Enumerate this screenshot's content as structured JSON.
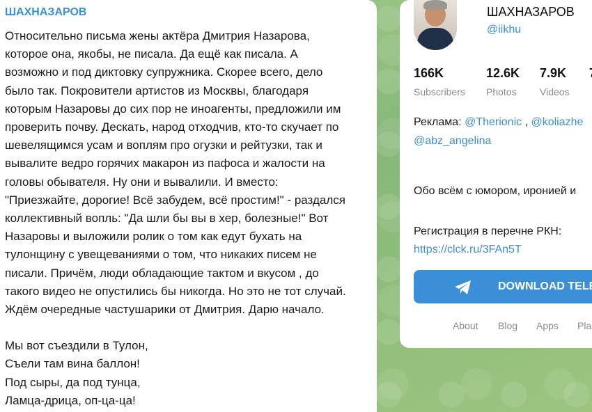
{
  "message": {
    "author": "ШАХНАЗАРОВ",
    "paragraph1": "Относительно письма жены актёра Дмитрия Назарова,\nкоторое она, якобы, не писала. Да ещё как писала. А\nвозможно и под диктовку супружника. Скорее всего, дело\nбыло так. Покровители артистов из Москвы, благодаря\nкоторым Назаровы до сих пор не иноагенты, предложили им\nпроверить почву. Дескать, народ отходчив, кто-то скучает по\nшевелящимся усам и воплям про огузки и рейтузки, так и\nвывалите ведро горячих макарон из пафоса и жалости на\nголовы обывателя. Ну они и вывалили. И вместо:\n\"Приезжайте, дорогие! Всё забудем, всё простим!\" - раздался\nколлективный вопль: \"Да шли бы вы в хер, болезные!\" Вот\nНазаровы и выложили ролик о том как едут бухать на\nтулонщину с увещеваниями о том, что никаких писем не\nписали. Причём, люди обладающие тактом и вкусом , до\nтакого видео не опустились бы никогда. Но это не тот случай.\nЖдём очередные частушарики от Дмитрия. Дарю начало.",
    "poem": "Мы вот съездили в Тулон,\nСъели там вина баллон!\nПод сыры, да под тунца,\nЛамца-дрица, оп-ца-ца!"
  },
  "channel": {
    "name": "ШАХНАЗАРОВ",
    "handle": "@iikhu",
    "stats": [
      {
        "num": "166K",
        "label": "Subscribers"
      },
      {
        "num": "12.6K",
        "label": "Photos"
      },
      {
        "num": "7.9K",
        "label": "Videos"
      },
      {
        "num": "7",
        "label": ""
      }
    ],
    "ad_prefix": "Реклама: ",
    "ad_link1": "@Therionic",
    "ad_sep": " , ",
    "ad_link2": "@koliazhe",
    "ad_link3": "@abz_angelina",
    "about": "Обо всём с юмором, иронией и",
    "reg_text": "Регистрация в перечне РКН:",
    "reg_link": "https://clck.ru/3FAn5T",
    "download_label": "DOWNLOAD TELEGI",
    "footer_links": [
      "About",
      "Blog",
      "Apps",
      "Pla"
    ]
  },
  "colors": {
    "accent": "#3a8fd6",
    "background_green": "#8fbf7a",
    "muted": "#8a8a8a"
  }
}
